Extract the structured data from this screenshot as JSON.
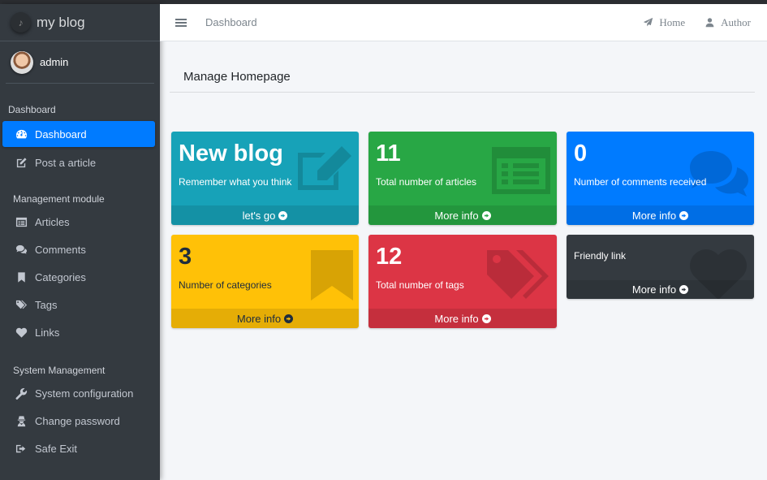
{
  "brand": {
    "title": "my blog"
  },
  "user": {
    "name": "admin"
  },
  "sidebar": {
    "header1": "Dashboard",
    "items1": [
      {
        "label": "Dashboard",
        "icon": "tachometer-icon",
        "active": true
      },
      {
        "label": "Post a article",
        "icon": "edit-icon"
      }
    ],
    "header2": "Management module",
    "items2": [
      {
        "label": "Articles",
        "icon": "list-alt-icon"
      },
      {
        "label": "Comments",
        "icon": "comments-icon"
      },
      {
        "label": "Categories",
        "icon": "bookmark-icon"
      },
      {
        "label": "Tags",
        "icon": "tags-icon"
      },
      {
        "label": "Links",
        "icon": "heart-icon"
      }
    ],
    "header3": "System Management",
    "items3": [
      {
        "label": "System configuration",
        "icon": "wrench-icon"
      },
      {
        "label": "Change password",
        "icon": "user-secret-icon"
      },
      {
        "label": "Safe Exit",
        "icon": "sign-out-icon"
      }
    ]
  },
  "topbar": {
    "breadcrumb": "Dashboard",
    "links": [
      {
        "label": "Home",
        "icon": "paper-plane-icon"
      },
      {
        "label": "Author",
        "icon": "user-icon"
      }
    ]
  },
  "main": {
    "page_title": "Manage Homepage",
    "boxes": [
      {
        "big": "New blog",
        "desc": "Remember what you think",
        "footer": "let's go",
        "color": "#17a2b8",
        "icon": "pencil-square-icon"
      },
      {
        "big": "11",
        "desc": "Total number of articles",
        "footer": "More info",
        "color": "#28a745",
        "icon": "list-alt-icon"
      },
      {
        "big": "0",
        "desc": "Number of comments received",
        "footer": "More info",
        "color": "#007bff",
        "icon": "comments-icon"
      },
      {
        "big": "3",
        "desc": "Number of categories",
        "footer": "More info",
        "color": "#ffc107",
        "icon": "bookmark-icon"
      },
      {
        "big": "12",
        "desc": "Total number of tags",
        "footer": "More info",
        "color": "#dc3545",
        "icon": "tags-icon"
      },
      {
        "big": "",
        "desc": "Friendly link",
        "footer": "More info",
        "color": "#343a40",
        "icon": "heart-icon"
      }
    ]
  }
}
